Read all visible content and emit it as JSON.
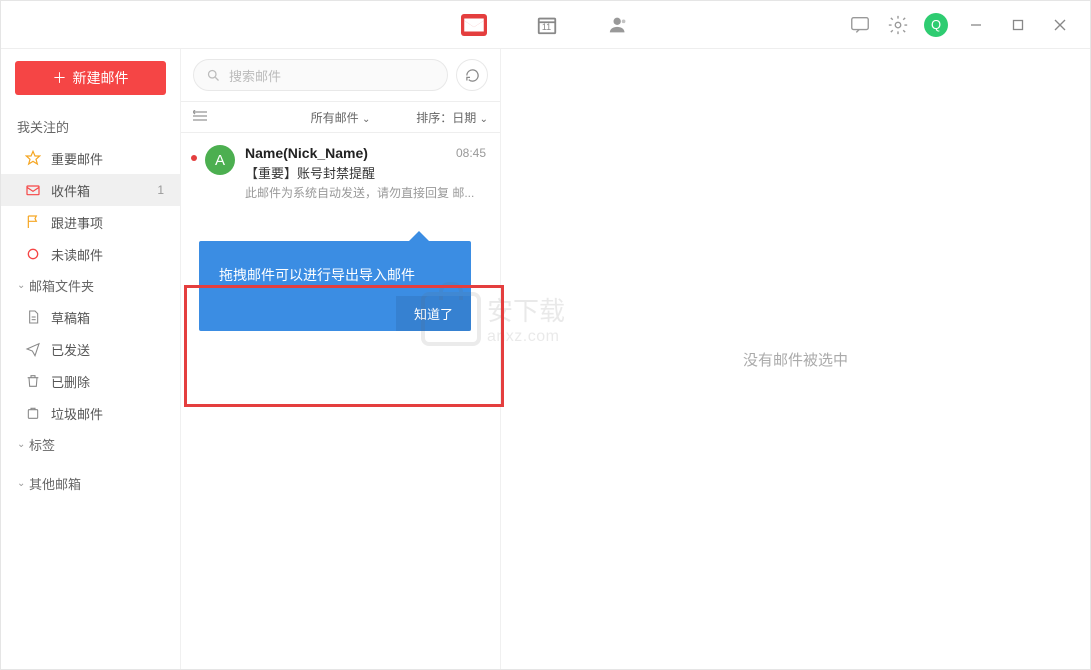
{
  "titlebar": {
    "calendar_day": "11",
    "avatar_letter": "Q"
  },
  "sidebar": {
    "compose": "新建邮件",
    "focus_title": "我关注的",
    "items_focus": [
      {
        "label": "重要邮件"
      },
      {
        "label": "收件箱",
        "badge": "1"
      },
      {
        "label": "跟进事项"
      },
      {
        "label": "未读邮件"
      }
    ],
    "folders_title": "邮箱文件夹",
    "items_folders": [
      {
        "label": "草稿箱"
      },
      {
        "label": "已发送"
      },
      {
        "label": "已删除"
      },
      {
        "label": "垃圾邮件"
      }
    ],
    "tags_title": "标签",
    "others_title": "其他邮箱"
  },
  "list": {
    "search_placeholder": "搜索邮件",
    "filter_all": "所有邮件",
    "sort_label": "排序：日期",
    "mail": {
      "sender": "Name(Nick_Name)",
      "time": "08:45",
      "subject": "【重要】账号封禁提醒",
      "snippet": "此邮件为系统自动发送，请勿直接回复 邮...",
      "avatar": "A"
    },
    "tip_text": "拖拽邮件可以进行导出导入邮件",
    "tip_btn": "知道了"
  },
  "detail": {
    "empty": "没有邮件被选中"
  },
  "watermark": {
    "cn": "安下载",
    "en": "anxz.com"
  }
}
